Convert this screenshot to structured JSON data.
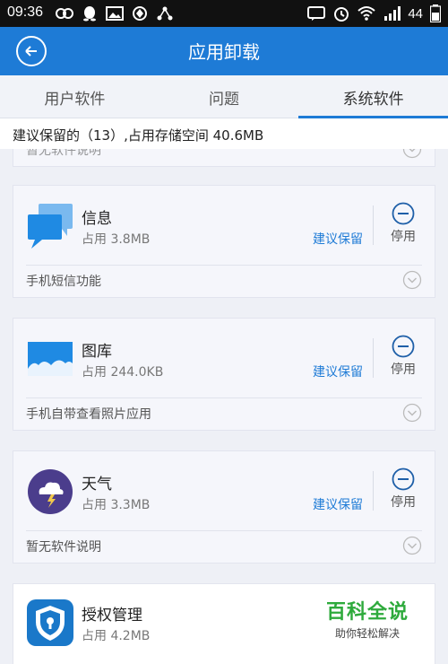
{
  "status_bar": {
    "time": "09:36",
    "battery": "44",
    "icons_left": [
      "infinity-icon",
      "qq-icon",
      "image-icon",
      "sync-icon",
      "share-icon"
    ],
    "icons_right": [
      "message-icon",
      "alarm-icon",
      "wifi-icon",
      "signal-icon"
    ]
  },
  "header": {
    "title": "应用卸载"
  },
  "tabs": [
    {
      "label": "用户软件",
      "active": false
    },
    {
      "label": "问题",
      "active": false
    },
    {
      "label": "系统软件",
      "active": true
    }
  ],
  "summary": "建议保留的（13）,占用存储空间 40.6MB",
  "partial_top_desc": "暂无软件说明",
  "apps": [
    {
      "name": "信息",
      "size": "占用 3.8MB",
      "keep": "建议保留",
      "action": "停用",
      "desc": "手机短信功能",
      "icon": "message-bubble-icon"
    },
    {
      "name": "图库",
      "size": "占用 244.0KB",
      "keep": "建议保留",
      "action": "停用",
      "desc": "手机自带查看照片应用",
      "icon": "gallery-icon"
    },
    {
      "name": "天气",
      "size": "占用 3.3MB",
      "keep": "建议保留",
      "action": "停用",
      "desc": "暂无软件说明",
      "icon": "weather-icon"
    }
  ],
  "bottom_app": {
    "name": "授权管理",
    "size": "占用 4.2MB",
    "icon": "shield-lock-icon"
  },
  "watermark": {
    "title": "百科全说",
    "subtitle": "助你轻松解决"
  },
  "colors": {
    "accent": "#1e7bd6",
    "statusbar": "#111111",
    "watermark_green": "#2eaa3c"
  }
}
